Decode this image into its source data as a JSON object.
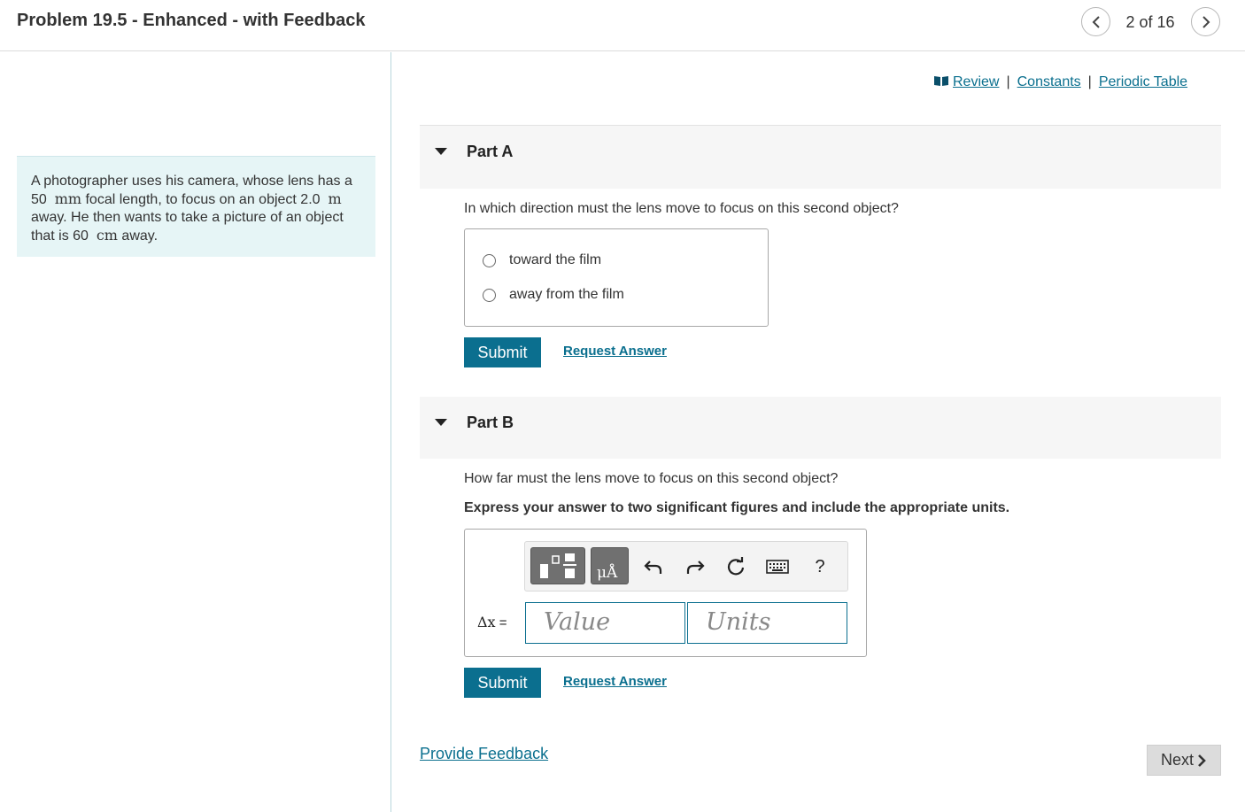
{
  "header": {
    "title": "Problem 19.5 - Enhanced - with Feedback",
    "pager": "2 of 16"
  },
  "intro": {
    "t1": "A photographer uses his camera, whose lens has a",
    "t2_num": "50",
    "t2_unit": "mm",
    "t2_rest": " focal length, to focus on an object 2.0",
    "t2_unit2": "m",
    "t3": "away. He then wants to take a picture of an object",
    "t4_pre": "that is 60",
    "t4_unit": "cm",
    "t4_post": " away."
  },
  "links": {
    "review": "Review",
    "constants": "Constants",
    "periodic": "Periodic Table",
    "sep": "|"
  },
  "part_a": {
    "title": "Part A",
    "question": "In which direction must the lens move to focus on this second object?",
    "choices": [
      "toward the film",
      "away from the film"
    ],
    "submit": "Submit",
    "request": "Request Answer"
  },
  "part_b": {
    "title": "Part B",
    "question": "How far must the lens move to focus on this second object?",
    "instruction": "Express your answer to two significant figures and include the appropriate units.",
    "variable": "Δx",
    "eq": " =",
    "value_placeholder": "Value",
    "units_placeholder": "Units",
    "units_btn": "μÅ",
    "help": "?",
    "submit": "Submit",
    "request": "Request Answer"
  },
  "footer": {
    "feedback": "Provide Feedback",
    "next": "Next"
  },
  "colors": {
    "accent": "#0b6f8f",
    "intro_bg": "#e6f5f6",
    "part_bg": "#f6f6f6"
  }
}
